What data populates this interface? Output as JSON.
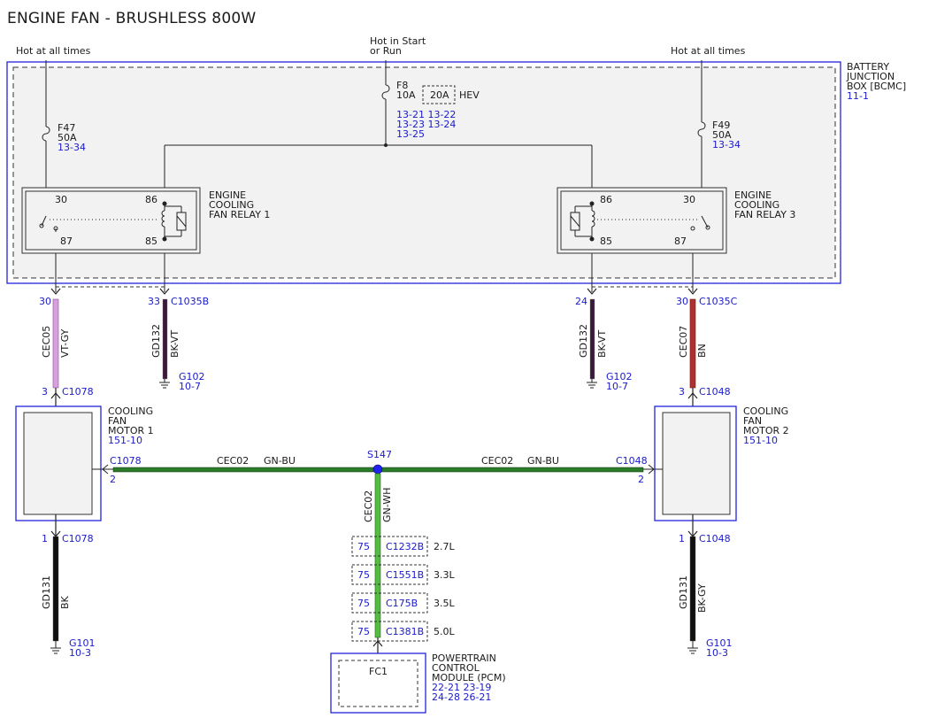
{
  "title": "ENGINE FAN - BRUSHLESS 800W",
  "power": {
    "left": "Hot at all times",
    "center_l1": "Hot in Start",
    "center_l2": "or Run",
    "right": "Hot at all times"
  },
  "bjb": {
    "l1": "BATTERY",
    "l2": "JUNCTION",
    "l3": "BOX [BCMC]",
    "ref": "11-1"
  },
  "fuses": {
    "f8": {
      "name": "F8",
      "amps": "10A",
      "alt": "20A",
      "alt_note": "HEV",
      "ref1": "13-21 13-22",
      "ref2": "13-23 13-24",
      "ref3": "13-25"
    },
    "f47": {
      "name": "F47",
      "amps": "50A",
      "ref": "13-34"
    },
    "f49": {
      "name": "F49",
      "amps": "50A",
      "ref": "13-34"
    }
  },
  "relays": {
    "r1": {
      "l1": "ENGINE",
      "l2": "COOLING",
      "l3": "FAN RELAY 1",
      "p30": "30",
      "p86": "86",
      "p87": "87",
      "p85": "85"
    },
    "r3": {
      "l1": "ENGINE",
      "l2": "COOLING",
      "l3": "FAN RELAY 3",
      "p30": "30",
      "p86": "86",
      "p87": "87",
      "p85": "85"
    }
  },
  "connectors": {
    "c1035b": {
      "pin": "33",
      "name": "C1035B"
    },
    "c1035c": {
      "pin": "30",
      "name": "C1035C"
    },
    "pin30_left": "30",
    "pin24": "24",
    "m1_top": {
      "pin": "3",
      "name": "C1078"
    },
    "m2_top": {
      "pin": "3",
      "name": "C1048"
    },
    "m1_side": {
      "pin": "2",
      "name": "C1078"
    },
    "m2_side": {
      "pin": "2",
      "name": "C1048"
    },
    "m1_bottom": {
      "pin": "1",
      "name": "C1078"
    },
    "m2_bottom": {
      "pin": "1",
      "name": "C1048"
    }
  },
  "wires": {
    "w_cec05": {
      "circuit": "CEC05",
      "color": "VT-GY"
    },
    "w_gd132_l": {
      "circuit": "GD132",
      "color": "BK-VT"
    },
    "w_gd132_r": {
      "circuit": "GD132",
      "color": "BK-VT"
    },
    "w_cec07": {
      "circuit": "CEC07",
      "color": "BN"
    },
    "w_cec02_l": {
      "circuit": "CEC02",
      "color": "GN-BU"
    },
    "w_cec02_r": {
      "circuit": "CEC02",
      "color": "GN-BU"
    },
    "w_cec02_v": {
      "circuit": "CEC02",
      "color": "GN-WH"
    },
    "w_gd131_l": {
      "circuit": "GD131",
      "color": "BK"
    },
    "w_gd131_r": {
      "circuit": "GD131",
      "color": "BK-GY"
    }
  },
  "grounds": {
    "g102_l": {
      "name": "G102",
      "ref": "10-7"
    },
    "g102_r": {
      "name": "G102",
      "ref": "10-7"
    },
    "g101_l": {
      "name": "G101",
      "ref": "10-3"
    },
    "g101_r": {
      "name": "G101",
      "ref": "10-3"
    }
  },
  "splice": "S147",
  "motors": {
    "m1": {
      "l1": "COOLING",
      "l2": "FAN",
      "l3": "MOTOR 1",
      "ref": "151-10"
    },
    "m2": {
      "l1": "COOLING",
      "l2": "FAN",
      "l3": "MOTOR 2",
      "ref": "151-10"
    }
  },
  "pcm_options": [
    {
      "pin": "75",
      "conn": "C1232B",
      "engine": "2.7L"
    },
    {
      "pin": "75",
      "conn": "C1551B",
      "engine": "3.3L"
    },
    {
      "pin": "75",
      "conn": "C175B",
      "engine": "3.5L"
    },
    {
      "pin": "75",
      "conn": "C1381B",
      "engine": "5.0L"
    }
  ],
  "pcm": {
    "pin": "FC1",
    "l1": "POWERTRAIN",
    "l2": "CONTROL",
    "l3": "MODULE (PCM)",
    "ref1": "22-21 23-19",
    "ref2": "24-28 26-21"
  },
  "colors": {
    "blue_box": "#2222dd",
    "ref_text": "#1a1acc",
    "wire_vt_gy": "#d9a0e0",
    "wire_bk_vt": "#3a1a3a",
    "wire_bn": "#b03030",
    "wire_gn": "#2a7a2a",
    "wire_gn_wh": "#55bb44",
    "wire_bk": "#111111"
  }
}
